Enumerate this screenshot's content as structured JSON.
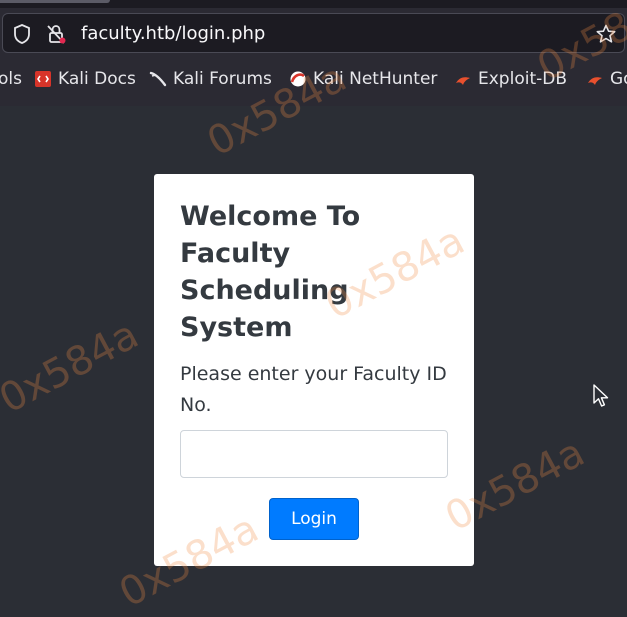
{
  "browser": {
    "url": "faculty.htb/login.php",
    "bookmarks": [
      {
        "label": "ols",
        "icon": "none"
      },
      {
        "label": "Kali Docs",
        "icon": "kali-docs-icon"
      },
      {
        "label": "Kali Forums",
        "icon": "kali-forums-icon"
      },
      {
        "label": "Kali NetHunter",
        "icon": "kali-nethunter-icon"
      },
      {
        "label": "Exploit-DB",
        "icon": "exploit-db-icon"
      },
      {
        "label": "Go",
        "icon": "exploit-db-icon"
      }
    ]
  },
  "login": {
    "title": "Welcome To Faculty Scheduling System",
    "prompt": "Please enter your Faculty ID No.",
    "input_value": "",
    "button_label": "Login"
  },
  "watermark": "0x584a",
  "colors": {
    "page_bg": "#2b2e35",
    "toolbar_bg": "#2b2a33",
    "button_primary": "#007bff",
    "watermark": "#f08c46"
  }
}
